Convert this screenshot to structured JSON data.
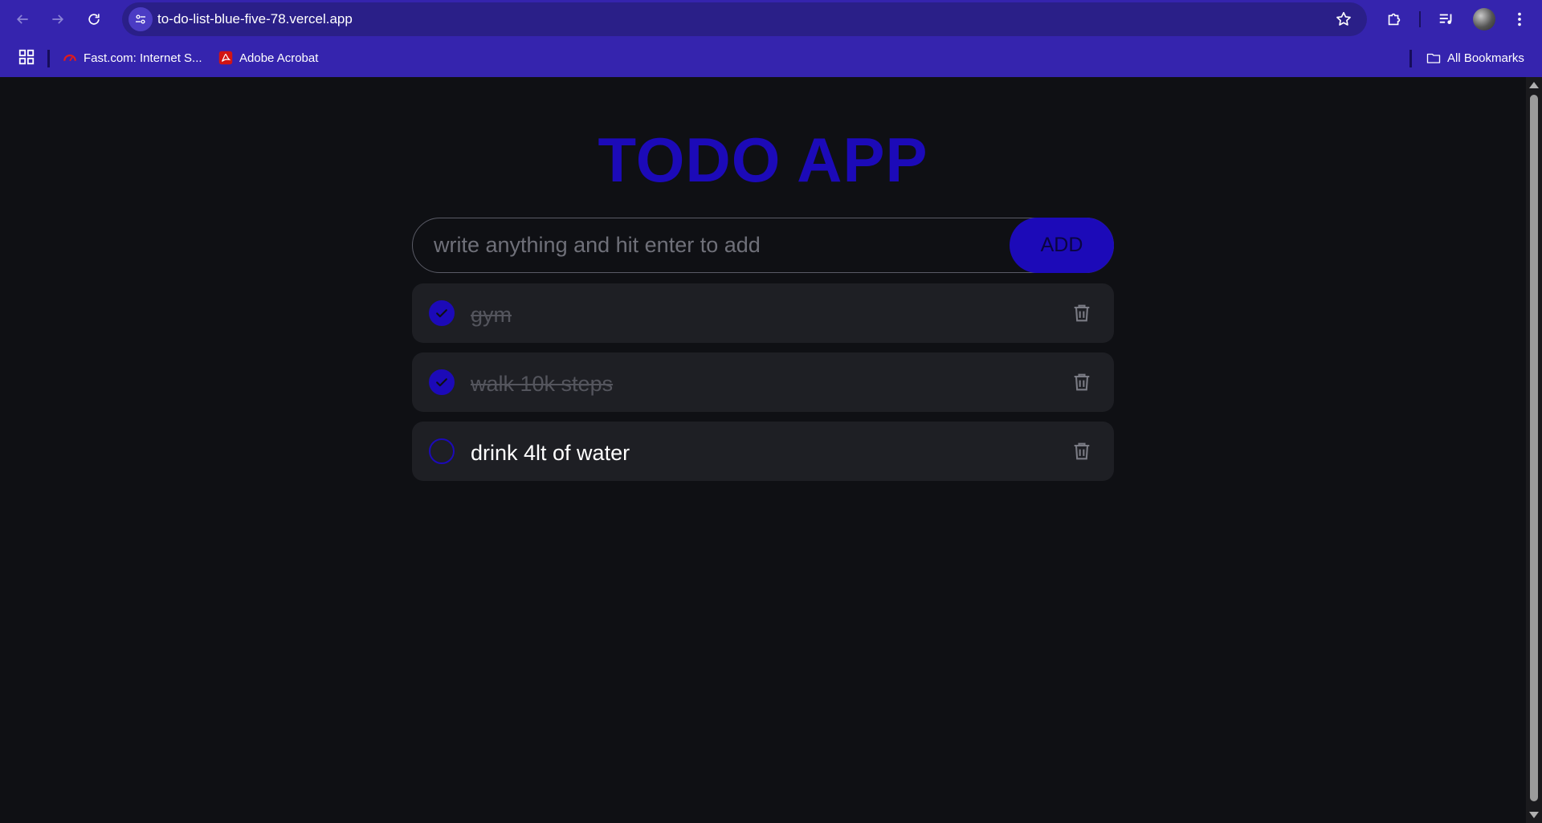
{
  "browser": {
    "url": "to-do-list-blue-five-78.vercel.app",
    "bookmarks": [
      {
        "label": "Fast.com: Internet S...",
        "icon": "speedometer-icon"
      },
      {
        "label": "Adobe Acrobat",
        "icon": "acrobat-icon"
      }
    ],
    "all_bookmarks_label": "All Bookmarks"
  },
  "app": {
    "title": "TODO APP",
    "input": {
      "placeholder": "write anything and hit enter to add",
      "value": ""
    },
    "add_label": "ADD",
    "todos": [
      {
        "text": "gym",
        "done": true
      },
      {
        "text": "walk 10k steps",
        "done": true
      },
      {
        "text": "drink 4lt of water",
        "done": false
      }
    ]
  },
  "colors": {
    "accent": "#1c0ab8",
    "chrome": "#3524ae",
    "page_bg": "#0f1014",
    "item_bg": "#1e1f24",
    "done_text": "#54555d"
  }
}
